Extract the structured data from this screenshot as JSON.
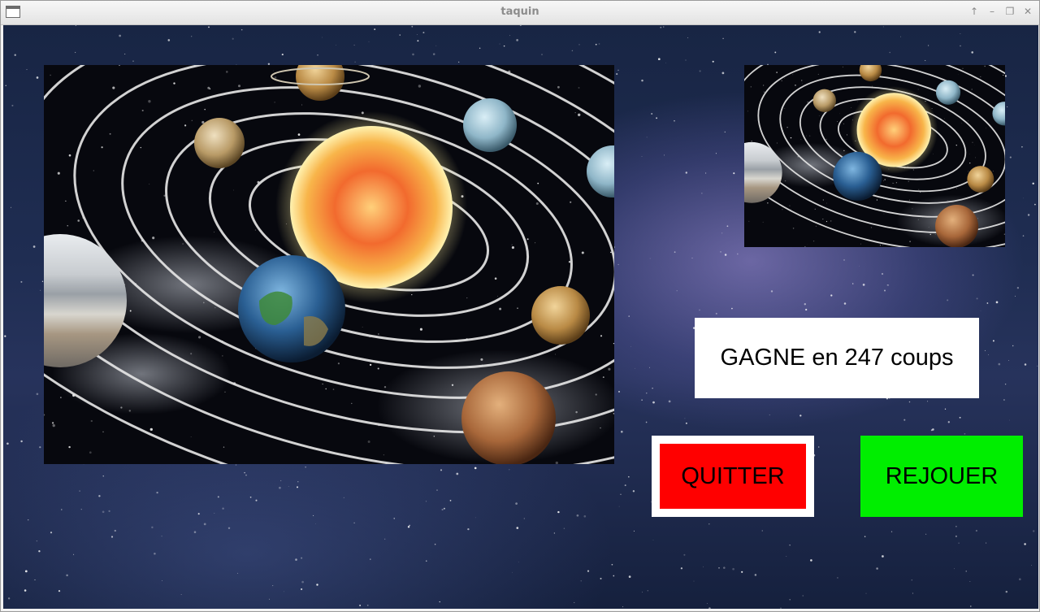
{
  "window": {
    "title": "taquin"
  },
  "game": {
    "status_text": "GAGNE en 247 coups",
    "quit_label": "QUITTER",
    "replay_label": "REJOUER"
  },
  "colors": {
    "quit_button": "#ff0000",
    "replay_button": "#00ee00",
    "status_box": "#ffffff",
    "background": "#1f2d52"
  },
  "icons": {
    "window_menu": "window-menu-icon",
    "keep_above": "arrow-up-icon",
    "minimize": "minimize-icon",
    "maximize": "maximize-icon",
    "close": "close-icon"
  }
}
